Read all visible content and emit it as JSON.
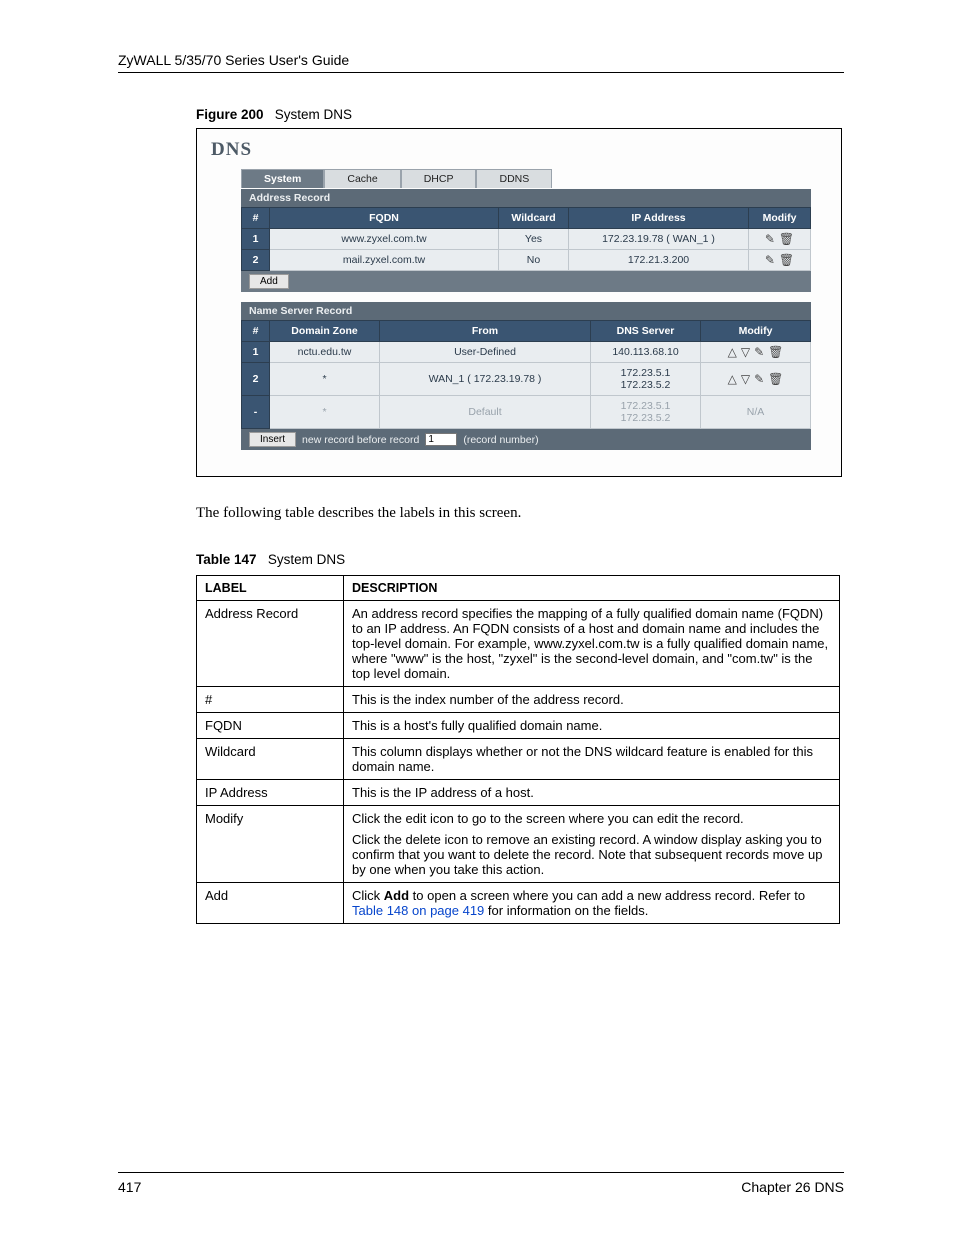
{
  "doc": {
    "header": "ZyWALL 5/35/70 Series User's Guide",
    "figure_label": "Figure 200",
    "figure_title": "System DNS",
    "intro_text": "The following table describes the labels in this screen.",
    "table_label": "Table 147",
    "table_title": "System DNS",
    "page_number": "417",
    "chapter": "Chapter 26 DNS"
  },
  "shot": {
    "title": "DNS",
    "tabs": [
      "System",
      "Cache",
      "DHCP",
      "DDNS"
    ],
    "active_tab": 0,
    "address_record": {
      "heading": "Address Record",
      "headers": {
        "num": "#",
        "fqdn": "FQDN",
        "wildcard": "Wildcard",
        "ip": "IP Address",
        "modify": "Modify"
      },
      "rows": [
        {
          "n": "1",
          "fqdn": "www.zyxel.com.tw",
          "wildcard": "Yes",
          "ip": "172.23.19.78 ( WAN_1 )"
        },
        {
          "n": "2",
          "fqdn": "mail.zyxel.com.tw",
          "wildcard": "No",
          "ip": "172.21.3.200"
        }
      ],
      "add_label": "Add"
    },
    "name_server_record": {
      "heading": "Name Server Record",
      "headers": {
        "num": "#",
        "zone": "Domain Zone",
        "from": "From",
        "server": "DNS Server",
        "modify": "Modify"
      },
      "rows": [
        {
          "n": "1",
          "zone": "nctu.edu.tw",
          "from": "User-Defined",
          "server": "140.113.68.10",
          "na": false
        },
        {
          "n": "2",
          "zone": "*",
          "from": "WAN_1 ( 172.23.19.78 )",
          "server": "172.23.5.1\n172.23.5.2",
          "na": false
        },
        {
          "n": "-",
          "zone": "*",
          "from": "Default",
          "server": "172.23.5.1\n172.23.5.2",
          "na": true,
          "na_label": "N/A"
        }
      ],
      "insert_label": "Insert",
      "insert_text_a": "new record before record",
      "insert_value": "1",
      "insert_text_b": "(record number)"
    }
  },
  "labels_table": {
    "head": {
      "label": "LABEL",
      "desc": "DESCRIPTION"
    },
    "rows": [
      {
        "label": "Address Record",
        "desc": "An address record specifies the mapping of a fully qualified domain name (FQDN) to an IP address. An FQDN consists of a host and domain name and includes the top-level domain. For example, www.zyxel.com.tw is a fully qualified domain name, where \"www\" is the host, \"zyxel\" is the second-level domain, and \"com.tw\" is the top level domain."
      },
      {
        "label": "#",
        "desc": "This is the index number of the address record."
      },
      {
        "label": "FQDN",
        "desc": "This is a host's fully qualified domain name."
      },
      {
        "label": "Wildcard",
        "desc": "This column displays whether or not the DNS wildcard feature is enabled for this domain name."
      },
      {
        "label": "IP Address",
        "desc": "This is the IP address of a host."
      },
      {
        "label": "Modify",
        "desc_multi": [
          "Click the edit icon to go to the screen where you can edit the record.",
          "Click the delete icon to remove an existing record. A window display asking you to confirm that you want to delete the record. Note that subsequent records move up by one when you take this action."
        ]
      },
      {
        "label": "Add",
        "desc_rich": {
          "pre": "Click ",
          "bold": "Add",
          "mid": " to open a screen where you can add a new address record. Refer to ",
          "link": "Table 148 on page 419",
          "post": " for information on the fields."
        }
      }
    ]
  }
}
